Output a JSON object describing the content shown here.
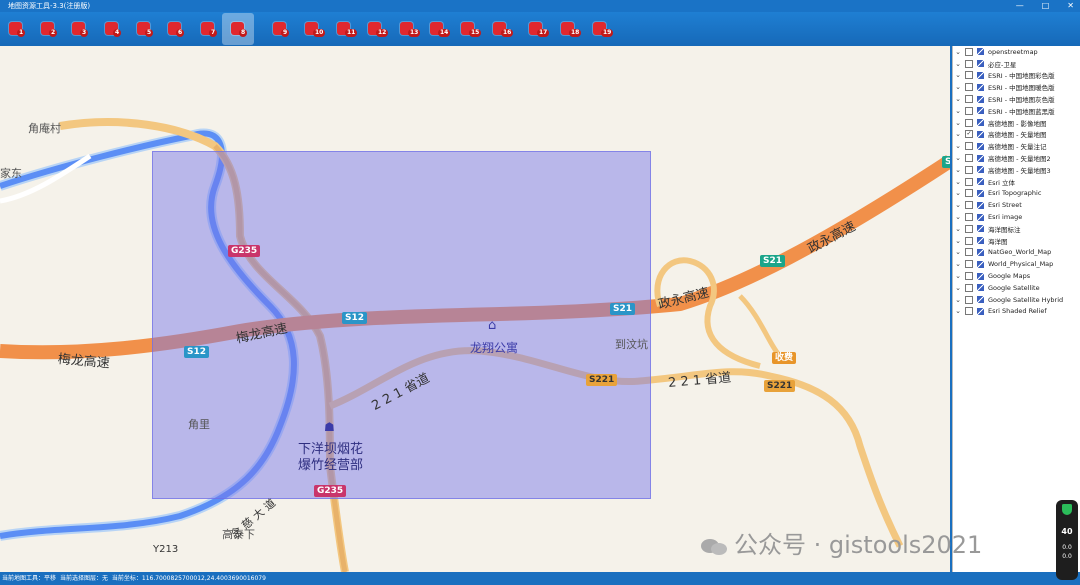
{
  "window": {
    "title": "地图资源工具-3.3(注册版)"
  },
  "toolbar": {
    "buttons": [
      {
        "badge": "1",
        "icon": "map-pin-icon"
      },
      {
        "badge": "2",
        "icon": "search-icon"
      },
      {
        "badge": "3",
        "icon": "pan-icon"
      },
      {
        "badge": "4",
        "icon": "zoom-in-icon"
      },
      {
        "badge": "5",
        "icon": "zoom-out-icon"
      },
      {
        "badge": "6",
        "icon": "full-extent-icon"
      },
      {
        "badge": "7",
        "icon": "download-icon"
      },
      {
        "badge": "8",
        "icon": "location-icon",
        "active": true
      },
      {
        "badge": "9",
        "icon": "polygon-icon"
      },
      {
        "badge": "10",
        "icon": "layers-icon"
      },
      {
        "badge": "11",
        "icon": "grid-icon"
      },
      {
        "badge": "12",
        "icon": "measure-icon"
      },
      {
        "badge": "13",
        "icon": "add-icon"
      },
      {
        "badge": "14",
        "icon": "export-icon"
      },
      {
        "badge": "15",
        "icon": "calendar-icon"
      },
      {
        "badge": "16",
        "icon": "user-icon"
      },
      {
        "badge": "17",
        "icon": "clock-icon"
      },
      {
        "badge": "18",
        "icon": "settings-icon"
      },
      {
        "badge": "19",
        "icon": "help-icon"
      }
    ]
  },
  "map": {
    "place_labels": {
      "jiaoan": "角庵村",
      "jiaoli": "角里",
      "daowenkeng": "到汶坑",
      "gaotaixia": "高泰下",
      "longxiang": "龙翔公寓",
      "firework_1": "下洋坝烟花",
      "firework_2": "爆竹经营部",
      "left_edge": "家东"
    },
    "road_labels": {
      "meilong_left": "梅龙高速",
      "meilong_mid": "梅龙高速",
      "zhengyong_1": "政永高速",
      "zhengyong_2": "政永高速",
      "prov221_1": "2 2 1 省道",
      "prov221_2": "2 2 1 省道",
      "nianzi": "念 慈 大 道"
    },
    "shields": {
      "g235_top": "G235",
      "g235_bot": "G235",
      "s12_left": "S12",
      "s12_mid": "S12",
      "s21_mid": "S21",
      "s21_right": "S21",
      "s221_mid": "S221",
      "s221_right": "S221",
      "toll": "收费",
      "y213": "Y213",
      "s_edge": "S"
    }
  },
  "layers": [
    {
      "name": "openstreetmap",
      "checked": false
    },
    {
      "name": "必应-卫星",
      "checked": false
    },
    {
      "name": "ESRI - 中国地图彩色版",
      "checked": false
    },
    {
      "name": "ESRI - 中国地图暖色版",
      "checked": false
    },
    {
      "name": "ESRI - 中国地图灰色版",
      "checked": false
    },
    {
      "name": "ESRI - 中国地图蓝黑版",
      "checked": false
    },
    {
      "name": "高德地图 - 影像地图",
      "checked": false
    },
    {
      "name": "高德地图 - 矢量地图",
      "checked": true
    },
    {
      "name": "高德地图 - 矢量注记",
      "checked": false
    },
    {
      "name": "高德地图 - 矢量地图2",
      "checked": false
    },
    {
      "name": "高德地图 - 矢量地图3",
      "checked": false
    },
    {
      "name": "Esri 立体",
      "checked": false
    },
    {
      "name": "Esri Topographic",
      "checked": false
    },
    {
      "name": "Esri Street",
      "checked": false
    },
    {
      "name": "Esri image",
      "checked": false
    },
    {
      "name": "海洋图标注",
      "checked": false
    },
    {
      "name": "海洋图",
      "checked": false
    },
    {
      "name": "NatGeo_World_Map",
      "checked": false
    },
    {
      "name": "World_Physical_Map",
      "checked": false
    },
    {
      "name": "Google Maps",
      "checked": false
    },
    {
      "name": "Google Satellite",
      "checked": false
    },
    {
      "name": "Google Satellite Hybrid",
      "checked": false
    },
    {
      "name": "Esri Shaded Relief",
      "checked": false
    }
  ],
  "status": {
    "tool": "当前地图工具：平移",
    "selection": "当前选择图层：无",
    "coords": "当前坐标：116.7000825700012,24.4003690016079"
  },
  "gauge": {
    "percent": "40",
    "up": "0.0",
    "down": "0.0",
    "unit": "K/s"
  },
  "watermark": "公众号 · gistools2021",
  "colors": {
    "accent": "#1a6fbf",
    "selection": "#7878eb",
    "highway": "#f0a060"
  }
}
